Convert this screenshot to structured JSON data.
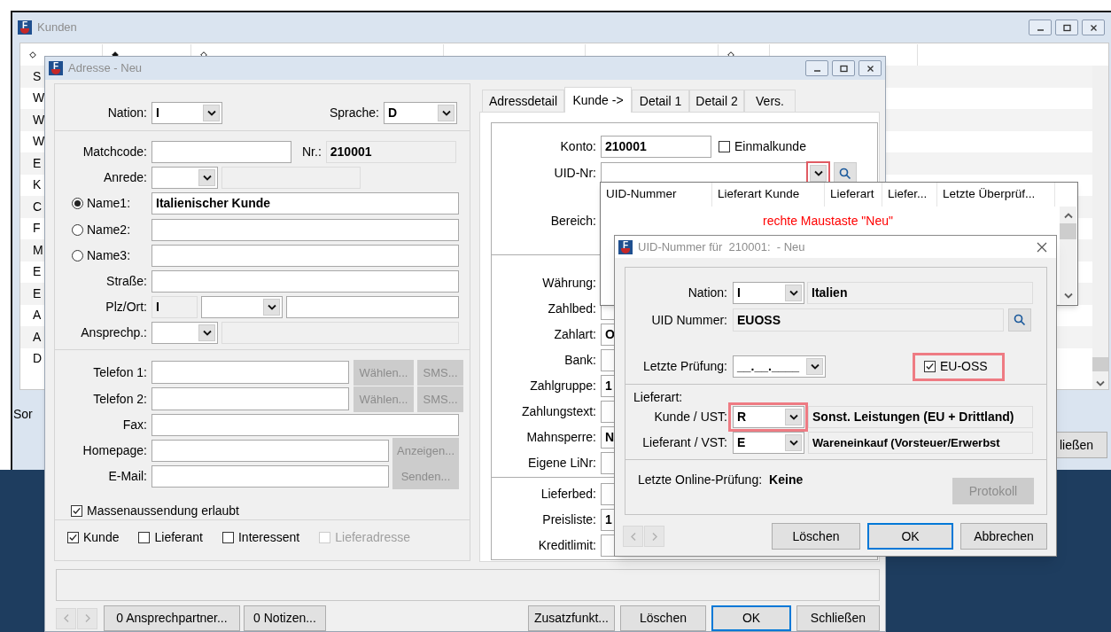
{
  "background_window": {
    "icon_letter": "F",
    "title": "Kunden",
    "sort_indicators": [
      false,
      true,
      false,
      false
    ],
    "rows": [
      "S",
      "W",
      "W",
      "W",
      "E",
      "K",
      "C",
      "F",
      "M",
      "E",
      "E",
      "A",
      "A",
      "D"
    ],
    "sort_label": "Sor",
    "close_button": "ließen"
  },
  "address_window": {
    "icon_letter": "F",
    "title": "Adresse - Neu",
    "nation": {
      "label": "Nation:",
      "value": "I"
    },
    "language": {
      "label": "Sprache:",
      "value": "D"
    },
    "matchcode": {
      "label": "Matchcode:"
    },
    "number": {
      "label": "Nr.:",
      "value": "210001"
    },
    "salutation": {
      "label": "Anrede:"
    },
    "names": [
      {
        "label": "Name1:",
        "selected": true,
        "value": "Italienischer Kunde"
      },
      {
        "label": "Name2:",
        "selected": false
      },
      {
        "label": "Name3:",
        "selected": false
      }
    ],
    "street": {
      "label": "Straße:"
    },
    "zip_city": {
      "label": "Plz/Ort:",
      "country": "I"
    },
    "contact": {
      "label": "Ansprechp.:"
    },
    "phones": [
      {
        "label": "Telefon 1:",
        "dial": "Wählen...",
        "sms": "SMS..."
      },
      {
        "label": "Telefon 2:",
        "dial": "Wählen...",
        "sms": "SMS..."
      }
    ],
    "fax": {
      "label": "Fax:"
    },
    "homepage": {
      "label": "Homepage:",
      "button": "Anzeigen..."
    },
    "email": {
      "label": "E-Mail:",
      "button": "Senden..."
    },
    "mass_mailing": {
      "label": "Massenaussendung erlaubt",
      "checked": true
    },
    "roles": [
      {
        "label": "Kunde",
        "checked": true,
        "disabled": false
      },
      {
        "label": "Lieferant",
        "checked": false,
        "disabled": false
      },
      {
        "label": "Interessent",
        "checked": false,
        "disabled": false
      },
      {
        "label": "Lieferadresse",
        "checked": false,
        "disabled": true
      }
    ],
    "tabs": [
      {
        "label": "Adressdetail",
        "selected": false
      },
      {
        "label": "Kunde ->",
        "selected": true
      },
      {
        "label": "Detail 1",
        "selected": false
      },
      {
        "label": "Detail 2",
        "selected": false
      },
      {
        "label": "Vers.",
        "selected": false
      }
    ],
    "account": {
      "label": "Konto:",
      "value": "210001"
    },
    "one_time": {
      "label": "Einmalkunde",
      "checked": false
    },
    "uid": {
      "label": "UID-Nr:"
    },
    "area": {
      "label": "Bereich:"
    },
    "payment_fields": [
      {
        "label": "Währung:",
        "kind": "plain"
      },
      {
        "label": "Zahlbed:",
        "kind": "field"
      },
      {
        "label": "Zahlart:",
        "kind": "field",
        "value": "O"
      },
      {
        "label": "Bank:",
        "kind": "field"
      },
      {
        "label": "Zahlgruppe:",
        "kind": "field",
        "value": "1"
      },
      {
        "label": "Zahlungstext:",
        "kind": "field"
      },
      {
        "label": "Mahnsperre:",
        "kind": "field",
        "value": "N"
      },
      {
        "label": "Eigene LiNr:",
        "kind": "field"
      }
    ],
    "delivery_fields": [
      {
        "label": "Lieferbed:",
        "kind": "field"
      },
      {
        "label": "Preisliste:",
        "kind": "field",
        "value": "1"
      },
      {
        "label": "Kreditlimit:",
        "kind": "field"
      }
    ],
    "footer_left": [
      "0 Ansprechpartner...",
      "0 Notizen..."
    ],
    "footer_right": [
      {
        "label": "Zusatzfunkt...",
        "default": false
      },
      {
        "label": "Löschen",
        "default": false
      },
      {
        "label": "OK",
        "default": true
      },
      {
        "label": "Schließen",
        "default": false
      }
    ]
  },
  "uid_list": {
    "columns": [
      "UID-Nummer",
      "Lieferart Kunde",
      "Lieferart",
      "Liefer...",
      "Letzte Überprüf..."
    ],
    "hint": "rechte Maustaste \"Neu\""
  },
  "uid_dialog": {
    "icon_letter": "F",
    "title": "UID-Nummer für  210001:  - Neu",
    "nation": {
      "label": "Nation:",
      "value": "I",
      "name": "Italien"
    },
    "uid": {
      "label": "UID Nummer:",
      "value": "EUOSS"
    },
    "last_check": {
      "label": "Letzte Prüfung:",
      "value": "__.__.____"
    },
    "eu_oss": {
      "label": "EU-OSS",
      "checked": true
    },
    "delivery_label": "Lieferart:",
    "customer": {
      "label": "Kunde / UST:",
      "value": "R",
      "text": "Sonst. Leistungen (EU + Drittland)"
    },
    "supplier": {
      "label": "Lieferant / VST:",
      "value": "E",
      "text": "Wareneinkauf (Vorsteuer/Erwerbst"
    },
    "online_check": {
      "label": "Letzte Online-Prüfung:",
      "value": "Keine"
    },
    "log_button": "Protokoll",
    "buttons": [
      {
        "label": "Löschen",
        "default": false
      },
      {
        "label": "OK",
        "default": true
      },
      {
        "label": "Abbrechen",
        "default": false
      }
    ]
  }
}
